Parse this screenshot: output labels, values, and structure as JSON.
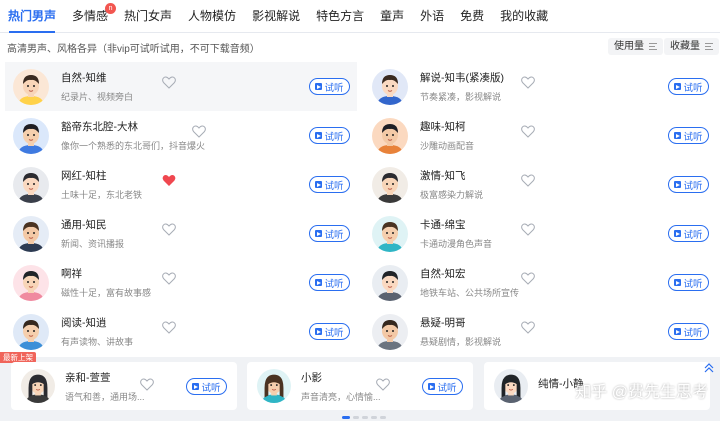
{
  "tabs": [
    {
      "label": "热门男声",
      "active": true
    },
    {
      "label": "多情感",
      "badge": "new"
    },
    {
      "label": "热门女声"
    },
    {
      "label": "人物模仿"
    },
    {
      "label": "影视解说"
    },
    {
      "label": "特色方言"
    },
    {
      "label": "童声"
    },
    {
      "label": "外语"
    },
    {
      "label": "免费"
    },
    {
      "label": "我的收藏"
    }
  ],
  "subtitle": "高清男声、风格各异（非vip可试听试用，不可下载音频）",
  "sort": {
    "usage": "使用量",
    "favorites": "收藏量"
  },
  "listen_label": "试听",
  "voices_left": [
    {
      "name": "自然-知维",
      "desc": "纪录片、视频旁白",
      "liked": false,
      "avatar": "beard-hat"
    },
    {
      "name": "豁帝东北腔-大林",
      "desc": "像你一个熟悉的东北哥们，抖音爆火",
      "liked": false,
      "avatar": "blue-shirt"
    },
    {
      "name": "网红-知柱",
      "desc": "土味十足，东北老铁",
      "liked": true,
      "avatar": "dark-shirt"
    },
    {
      "name": "通用-知民",
      "desc": "新闻、资讯播报",
      "liked": false,
      "avatar": "suit"
    },
    {
      "name": "啊祥",
      "desc": "磁性十足，富有故事感",
      "liked": false,
      "avatar": "pink-shirt"
    },
    {
      "name": "阅读-知逍",
      "desc": "有声读物、讲故事",
      "liked": false,
      "avatar": "young"
    }
  ],
  "voices_right": [
    {
      "name": "解说-知韦(紧凑版)",
      "desc": "节奏紧凑，影视解说",
      "liked": false,
      "avatar": "glasses"
    },
    {
      "name": "趣味-知柯",
      "desc": "沙雕动画配音",
      "liked": false,
      "avatar": "orange-bg"
    },
    {
      "name": "激情-知飞",
      "desc": "极富感染力解说",
      "liked": false,
      "avatar": "stubble"
    },
    {
      "name": "卡通-绵宝",
      "desc": "卡通动漫角色声音",
      "liked": false,
      "avatar": "cyan-shirt"
    },
    {
      "name": "自然-知宏",
      "desc": "地铁车站、公共场所宣传",
      "liked": false,
      "avatar": "spiky"
    },
    {
      "name": "悬疑-明哥",
      "desc": "悬疑剧情，影视解说",
      "liked": false,
      "avatar": "gray-shirt"
    }
  ],
  "new_tag": "最新上架",
  "new_voices": [
    {
      "name": "亲和-萱萱",
      "desc": "语气和善，通用场...",
      "liked": false
    },
    {
      "name": "小影",
      "desc": "声音清亮，心情愉...",
      "liked": false
    },
    {
      "name": "纯情-小静",
      "desc": "",
      "liked": false
    }
  ],
  "watermark": "知乎 @费先生思考",
  "colors": {
    "accent": "#2a6ef0",
    "heart_active": "#f0474f",
    "badge": "#f25650"
  }
}
